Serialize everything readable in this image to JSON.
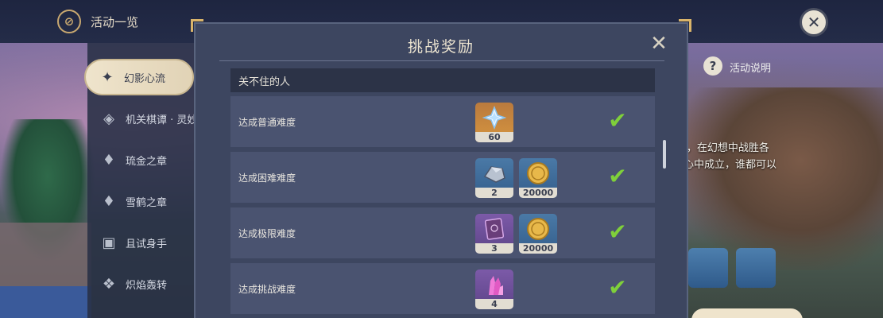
{
  "topbar": {
    "title": "活动一览"
  },
  "sidebar": {
    "items": [
      {
        "label": "幻影心流",
        "icon": "compass-star-icon",
        "active": true
      },
      {
        "label": "机关棋谭 · 灵妙",
        "icon": "mechanism-icon"
      },
      {
        "label": "琉金之章",
        "icon": "map-pin-icon"
      },
      {
        "label": "雪鹤之章",
        "icon": "map-pin-icon"
      },
      {
        "label": "且试身手",
        "icon": "cards-icon"
      },
      {
        "label": "炽焰轰转",
        "icon": "puzzle-icon"
      }
    ]
  },
  "help": {
    "label": "活动说明"
  },
  "description": {
    "line1": "J，在幻想中战胜各",
    "line2": "心中成立，谁都可以"
  },
  "dialog": {
    "title": "挑战奖励",
    "section": "关不住的人",
    "rows": [
      {
        "label": "达成普通难度",
        "rewards": [
          {
            "icon": "primogem-icon",
            "qty": "60",
            "bg": "gold"
          }
        ],
        "claimed": true
      },
      {
        "label": "达成困难难度",
        "rewards": [
          {
            "icon": "ore-icon",
            "qty": "2",
            "bg": "blue"
          },
          {
            "icon": "mora-coin-icon",
            "qty": "20000",
            "bg": "blue"
          }
        ],
        "claimed": true
      },
      {
        "label": "达成极限难度",
        "rewards": [
          {
            "icon": "book-icon",
            "qty": "3",
            "bg": "purple"
          },
          {
            "icon": "mora-coin-icon",
            "qty": "20000",
            "bg": "blue"
          }
        ],
        "claimed": true
      },
      {
        "label": "达成挑战难度",
        "rewards": [
          {
            "icon": "crystal-icon",
            "qty": "4",
            "bg": "purple"
          }
        ],
        "claimed": true
      }
    ]
  },
  "colors": {
    "accent": "#d9b46a",
    "check": "#7fd03a"
  }
}
